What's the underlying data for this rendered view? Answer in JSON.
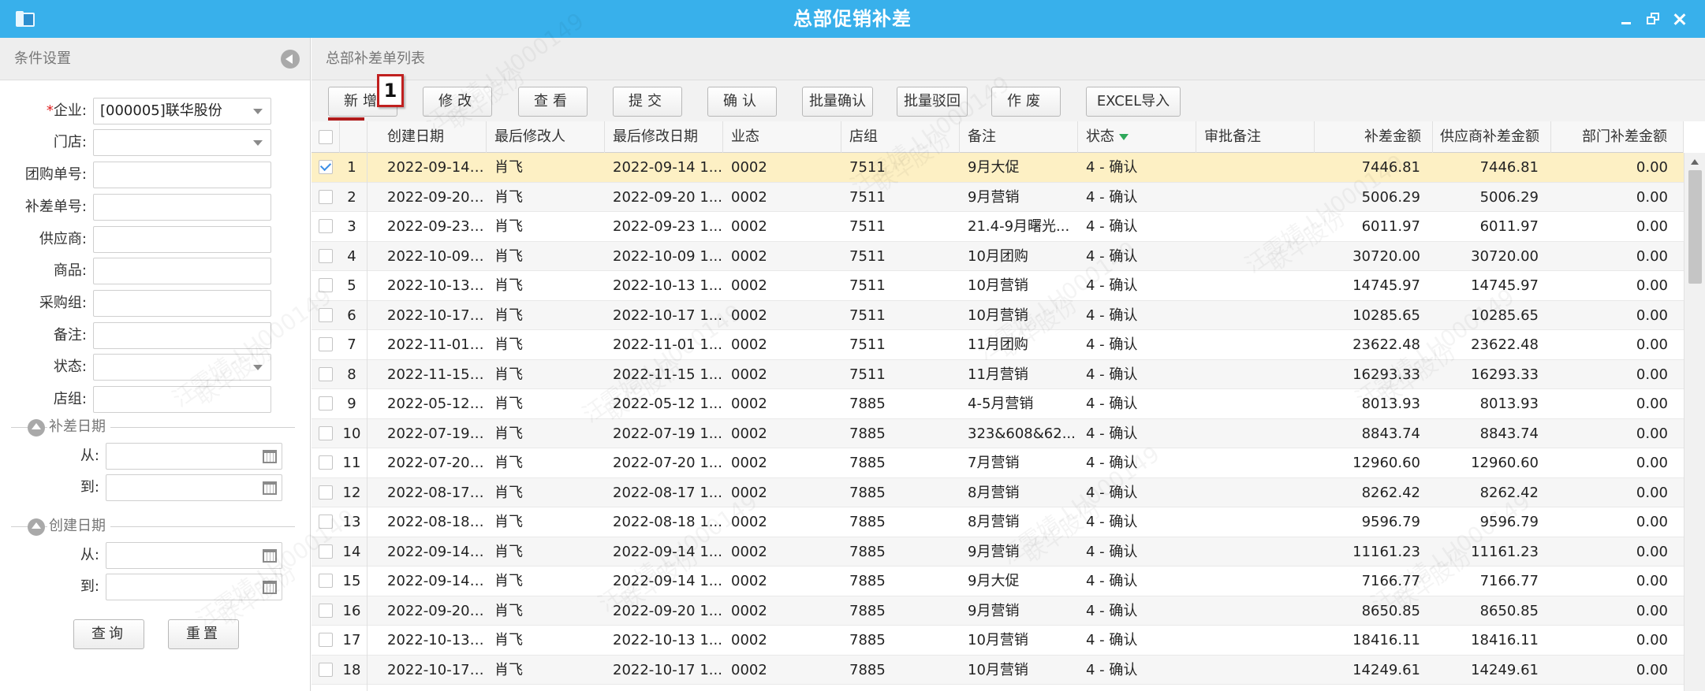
{
  "window": {
    "title": "总部促销补差"
  },
  "filter_panel": {
    "title": "条件设置",
    "fields": [
      {
        "label": "企业:",
        "required": true,
        "value": "[000005]联华股份",
        "type": "select"
      },
      {
        "label": "门店:",
        "value": "",
        "type": "select"
      },
      {
        "label": "团购单号:",
        "value": "",
        "type": "text"
      },
      {
        "label": "补差单号:",
        "value": "",
        "type": "text"
      },
      {
        "label": "供应商:",
        "value": "",
        "type": "text"
      },
      {
        "label": "商品:",
        "value": "",
        "type": "text"
      },
      {
        "label": "采购组:",
        "value": "",
        "type": "text"
      },
      {
        "label": "备注:",
        "value": "",
        "type": "text"
      },
      {
        "label": "状态:",
        "value": "",
        "type": "select"
      },
      {
        "label": "店组:",
        "value": "",
        "type": "text"
      }
    ],
    "section_diff_date": "补差日期",
    "section_create_date": "创建日期",
    "from_label": "从:",
    "to_label": "到:",
    "query_button": "查询",
    "reset_button": "重置"
  },
  "list_panel": {
    "title": "总部补差单列表",
    "toolbar": [
      "新增",
      "修改",
      "查看",
      "提交",
      "确认",
      "批量确认",
      "批量驳回",
      "作废",
      "EXCEL导入"
    ],
    "annotation_badge": "1",
    "columns": [
      "创建日期",
      "最后修改人",
      "最后修改日期",
      "业态",
      "店组",
      "备注",
      "状态",
      "审批备注",
      "补差金额",
      "供应商补差金额",
      "部门补差金额"
    ],
    "rows": [
      {
        "n": "1",
        "created": "2022-09-14 1...",
        "modifier": "肖飞",
        "modified": "2022-09-14 1...",
        "format": "0002",
        "group": "7511",
        "note": "9月大促",
        "status": "4 - 确认",
        "approval": "",
        "amount": "7446.81",
        "supplier": "7446.81",
        "dept": "0.00"
      },
      {
        "n": "2",
        "created": "2022-09-20 1...",
        "modifier": "肖飞",
        "modified": "2022-09-20 1...",
        "format": "0002",
        "group": "7511",
        "note": "9月营销",
        "status": "4 - 确认",
        "approval": "",
        "amount": "5006.29",
        "supplier": "5006.29",
        "dept": "0.00"
      },
      {
        "n": "3",
        "created": "2022-09-23 1...",
        "modifier": "肖飞",
        "modified": "2022-09-23 1...",
        "format": "0002",
        "group": "7511",
        "note": "21.4-9月曙光...",
        "status": "4 - 确认",
        "approval": "",
        "amount": "6011.97",
        "supplier": "6011.97",
        "dept": "0.00"
      },
      {
        "n": "4",
        "created": "2022-10-09 1...",
        "modifier": "肖飞",
        "modified": "2022-10-09 1...",
        "format": "0002",
        "group": "7511",
        "note": "10月团购",
        "status": "4 - 确认",
        "approval": "",
        "amount": "30720.00",
        "supplier": "30720.00",
        "dept": "0.00"
      },
      {
        "n": "5",
        "created": "2022-10-13 1...",
        "modifier": "肖飞",
        "modified": "2022-10-13 1...",
        "format": "0002",
        "group": "7511",
        "note": "10月营销",
        "status": "4 - 确认",
        "approval": "",
        "amount": "14745.97",
        "supplier": "14745.97",
        "dept": "0.00"
      },
      {
        "n": "6",
        "created": "2022-10-17 1...",
        "modifier": "肖飞",
        "modified": "2022-10-17 1...",
        "format": "0002",
        "group": "7511",
        "note": "10月营销",
        "status": "4 - 确认",
        "approval": "",
        "amount": "10285.65",
        "supplier": "10285.65",
        "dept": "0.00"
      },
      {
        "n": "7",
        "created": "2022-11-01 1...",
        "modifier": "肖飞",
        "modified": "2022-11-01 1...",
        "format": "0002",
        "group": "7511",
        "note": "11月团购",
        "status": "4 - 确认",
        "approval": "",
        "amount": "23622.48",
        "supplier": "23622.48",
        "dept": "0.00"
      },
      {
        "n": "8",
        "created": "2022-11-15 1...",
        "modifier": "肖飞",
        "modified": "2022-11-15 1...",
        "format": "0002",
        "group": "7511",
        "note": "11月营销",
        "status": "4 - 确认",
        "approval": "",
        "amount": "16293.33",
        "supplier": "16293.33",
        "dept": "0.00"
      },
      {
        "n": "9",
        "created": "2022-05-12 1...",
        "modifier": "肖飞",
        "modified": "2022-05-12 1...",
        "format": "0002",
        "group": "7885",
        "note": "4-5月营销",
        "status": "4 - 确认",
        "approval": "",
        "amount": "8013.93",
        "supplier": "8013.93",
        "dept": "0.00"
      },
      {
        "n": "10",
        "created": "2022-07-19 1...",
        "modifier": "肖飞",
        "modified": "2022-07-19 1...",
        "format": "0002",
        "group": "7885",
        "note": "323&608&62...",
        "status": "4 - 确认",
        "approval": "",
        "amount": "8843.74",
        "supplier": "8843.74",
        "dept": "0.00"
      },
      {
        "n": "11",
        "created": "2022-07-20 1...",
        "modifier": "肖飞",
        "modified": "2022-07-20 1...",
        "format": "0002",
        "group": "7885",
        "note": "7月营销",
        "status": "4 - 确认",
        "approval": "",
        "amount": "12960.60",
        "supplier": "12960.60",
        "dept": "0.00"
      },
      {
        "n": "12",
        "created": "2022-08-17 1...",
        "modifier": "肖飞",
        "modified": "2022-08-17 1...",
        "format": "0002",
        "group": "7885",
        "note": "8月营销",
        "status": "4 - 确认",
        "approval": "",
        "amount": "8262.42",
        "supplier": "8262.42",
        "dept": "0.00"
      },
      {
        "n": "13",
        "created": "2022-08-18 1...",
        "modifier": "肖飞",
        "modified": "2022-08-18 1...",
        "format": "0002",
        "group": "7885",
        "note": "8月营销",
        "status": "4 - 确认",
        "approval": "",
        "amount": "9596.79",
        "supplier": "9596.79",
        "dept": "0.00"
      },
      {
        "n": "14",
        "created": "2022-09-14 1...",
        "modifier": "肖飞",
        "modified": "2022-09-14 1...",
        "format": "0002",
        "group": "7885",
        "note": "9月营销",
        "status": "4 - 确认",
        "approval": "",
        "amount": "11161.23",
        "supplier": "11161.23",
        "dept": "0.00"
      },
      {
        "n": "15",
        "created": "2022-09-14 1...",
        "modifier": "肖飞",
        "modified": "2022-09-14 1...",
        "format": "0002",
        "group": "7885",
        "note": "9月大促",
        "status": "4 - 确认",
        "approval": "",
        "amount": "7166.77",
        "supplier": "7166.77",
        "dept": "0.00"
      },
      {
        "n": "16",
        "created": "2022-09-20 1...",
        "modifier": "肖飞",
        "modified": "2022-09-20 1...",
        "format": "0002",
        "group": "7885",
        "note": "9月营销",
        "status": "4 - 确认",
        "approval": "",
        "amount": "8650.85",
        "supplier": "8650.85",
        "dept": "0.00"
      },
      {
        "n": "17",
        "created": "2022-10-13 1...",
        "modifier": "肖飞",
        "modified": "2022-10-13 1...",
        "format": "0002",
        "group": "7885",
        "note": "10月营销",
        "status": "4 - 确认",
        "approval": "",
        "amount": "18416.11",
        "supplier": "18416.11",
        "dept": "0.00"
      },
      {
        "n": "18",
        "created": "2022-10-17 1...",
        "modifier": "肖飞",
        "modified": "2022-10-17 1...",
        "format": "0002",
        "group": "7885",
        "note": "10月营销",
        "status": "4 - 确认",
        "approval": "",
        "amount": "14249.61",
        "supplier": "14249.61",
        "dept": "0.00"
      }
    ],
    "selected_row": 1
  },
  "watermark": [
    "汪雯婧-LH000149",
    "联华股份"
  ],
  "colors": {
    "titlebar": "#38b0eb",
    "selected_row": "#fdf0c4",
    "annotation": "#c0201f",
    "sort_icon": "#2ea85a"
  }
}
